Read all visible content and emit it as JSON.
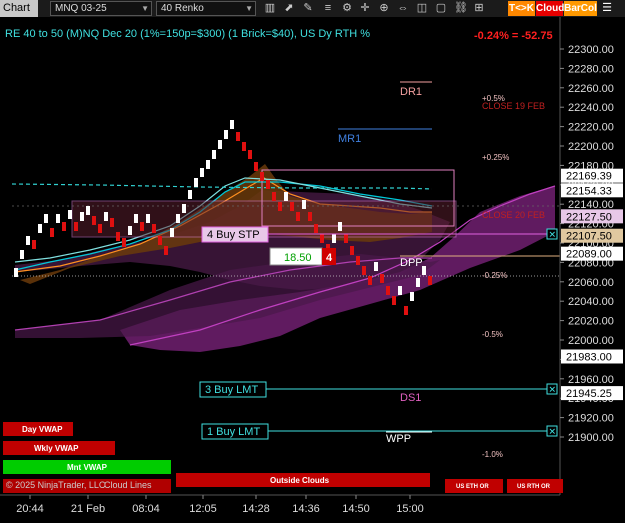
{
  "toolbar": {
    "chart_label": "Chart",
    "symbol": "MNQ 03-25",
    "interval": "40 Renko",
    "tk_label": "T<>K",
    "cloud_label": "Cloud",
    "barcol_label": "BarCol"
  },
  "chart": {
    "header": "RE 40 to 50 (M)NQ Dec 20 (1%=150p=$300) (1 Brick=$40), US Dy RTH %",
    "change": "-0.24% = -52.75",
    "copyright": "© 2025 NinjaTrader, LLC",
    "cloud_lines_label": "Cloud Lines",
    "price_labels": [
      "22300.00",
      "22280.00",
      "22260.00",
      "22240.00",
      "22220.00",
      "22200.00",
      "22180.00",
      "22160.00",
      "22140.00",
      "22120.00",
      "22100.00",
      "22080.00",
      "22060.00",
      "22040.00",
      "22020.00",
      "22000.00",
      "21980.00",
      "21960.00",
      "21940.00",
      "21920.00",
      "21900.00"
    ],
    "time_labels": [
      "20:44",
      "21 Feb",
      "08:04",
      "12:05",
      "14:28",
      "14:36",
      "14:50",
      "15:00"
    ],
    "price_tags": [
      {
        "text": "22169.39",
        "price": 22169.39
      },
      {
        "text": "22154.33",
        "price": 22154.33
      },
      {
        "text": "22127.50",
        "price": 22127.5
      },
      {
        "text": "22107.50",
        "price": 22107.5
      },
      {
        "text": "22089.00",
        "price": 22089.0
      },
      {
        "text": "21983.00",
        "price": 21983.0
      },
      {
        "text": "21945.25",
        "price": 21945.25
      }
    ],
    "levels": {
      "dr1": "DR1",
      "mr1": "MR1",
      "dpp": "DPP",
      "ds1": "DS1",
      "wpp": "WPP",
      "pct_p05": "+0.5%",
      "pct_p025": "+0.25%",
      "pct_m025": "-0.25%",
      "pct_m05": "-0.5%",
      "pct_m1": "-1.0%",
      "close19": "CLOSE 19 FEB",
      "close20": "CLOSE 20 FEB"
    },
    "orders": {
      "stop": {
        "label": "4 Buy STP",
        "price": 22127.5
      },
      "lmt1": {
        "label": "3 Buy LMT",
        "price": 21983.0
      },
      "lmt2": {
        "label": "1 Buy LMT",
        "price": 21945.25
      }
    },
    "order_entry": {
      "value": "18.50",
      "qty": "4"
    },
    "buttons": {
      "day_vwap": "Day VWAP",
      "wkly_vwap": "Wkly VWAP",
      "mnt_vwap": "Mnt VWAP",
      "outside_clouds": "Outside Clouds",
      "us_eth_or": "US ETH OR",
      "us_rth_or": "US RTH OR"
    }
  },
  "colors": {
    "background": "#000000",
    "up_brick": "#ffffff",
    "down_brick": "#e01010",
    "accent_cyan": "#00e5e5",
    "magenta": "#c040c0",
    "cloud_orange": "#b06818",
    "buy_order": "#40e0e0",
    "red_button": "#c00000",
    "green_button": "#00cc00"
  }
}
